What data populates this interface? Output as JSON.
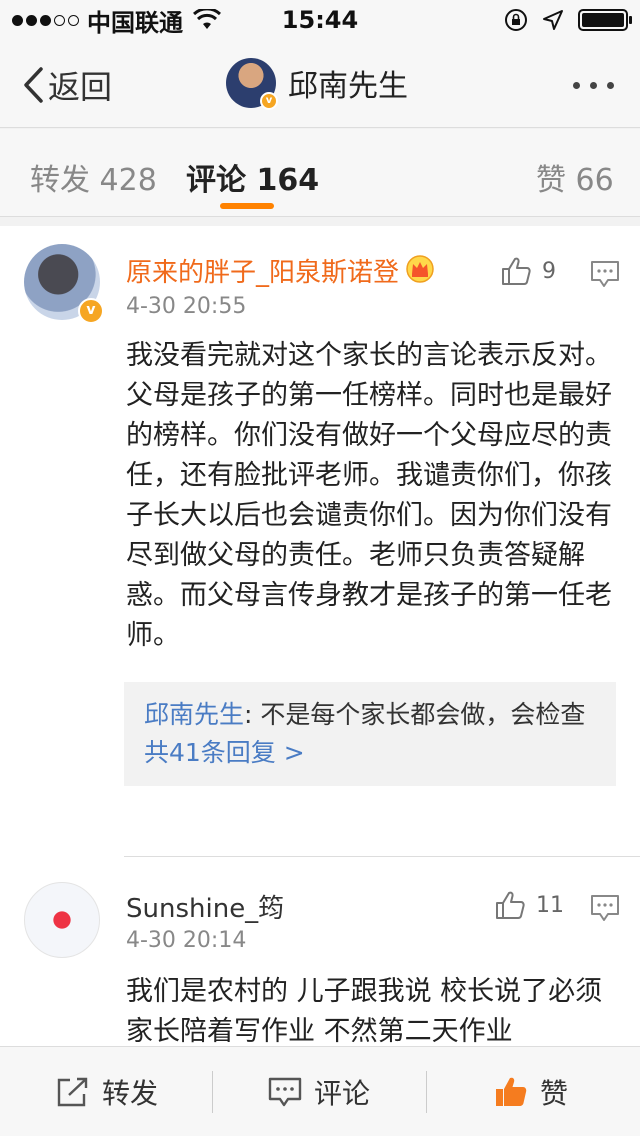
{
  "status_bar": {
    "carrier": "中国联通",
    "time": "15:44"
  },
  "nav": {
    "back_label": "返回",
    "title": "邱南先生"
  },
  "tabs": [
    {
      "label": "转发",
      "count": "428"
    },
    {
      "label": "评论",
      "count": "164"
    },
    {
      "label": "赞",
      "count": "66"
    }
  ],
  "comments": [
    {
      "author": "原来的胖子_阳泉斯诺登",
      "time": "4-30 20:55",
      "likes": "9",
      "text": "我没看完就对这个家长的言论表示反对。父母是孩子的第一任榜样。同时也是最好的榜样。你们没有做好一个父母应尽的责任，还有脸批评老师。我谴责你们，你孩子长大以后也会谴责你们。因为你们没有尽到做父母的责任。老师只负责答疑解惑。而父母言传身教才是孩子的第一任老师。",
      "reply": {
        "author": "邱南先生",
        "text": ": 不是每个家长都会做，会检查",
        "more": "共41条回复 >"
      }
    },
    {
      "author": "Sunshine_筠",
      "time": "4-30 20:14",
      "likes": "11",
      "text": "我们是农村的 儿子跟我说 校长说了必须家长陪着写作业 不然第二天作业"
    }
  ],
  "toolbar": {
    "repost": "转发",
    "comment": "评论",
    "like": "赞"
  },
  "colors": {
    "accent": "#ff8200",
    "vip_name": "#f06a1b",
    "link": "#4a7cc4"
  }
}
